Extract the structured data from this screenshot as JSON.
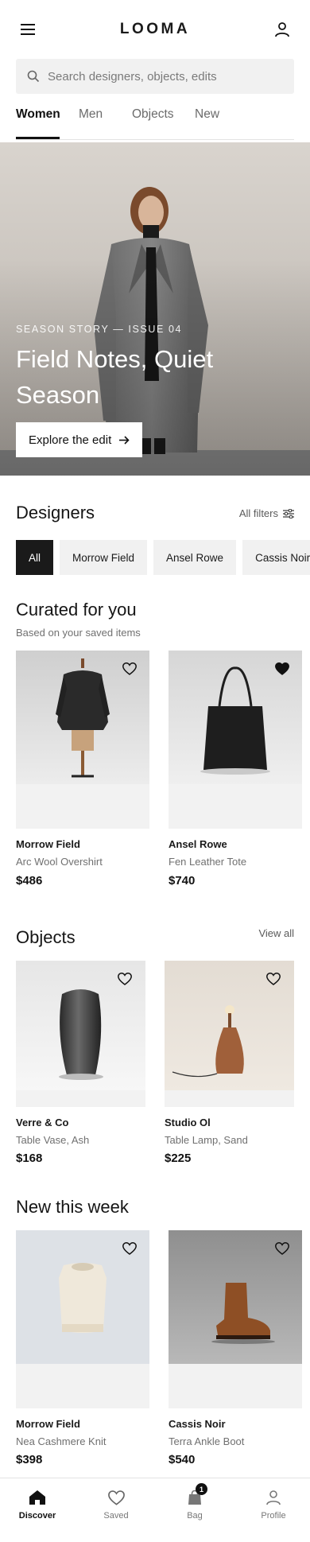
{
  "header": {
    "brand": "LOOMA",
    "menu_icon": "menu-icon",
    "profile_icon": "user-icon"
  },
  "search": {
    "placeholder": "Search designers, objects, edits",
    "icon": "search-icon"
  },
  "tabs": [
    {
      "label": "Women",
      "active": true
    },
    {
      "label": "Men",
      "active": false
    },
    {
      "label": "Objects",
      "active": false
    },
    {
      "label": "New",
      "active": false
    }
  ],
  "hero": {
    "eyebrow": "SEASON STORY — ISSUE 04",
    "title": "Field Notes, Quiet Season",
    "cta_label": "Explore the edit",
    "cta_icon": "arrow-right-icon"
  },
  "designers": {
    "title": "Designers",
    "filters_label": "All filters",
    "filters_icon": "sliders-icon",
    "chips": [
      {
        "label": "All",
        "active": true
      },
      {
        "label": "Morrow Field",
        "active": false
      },
      {
        "label": "Ansel Rowe",
        "active": false
      },
      {
        "label": "Cassis Noir",
        "active": false
      }
    ]
  },
  "curated": {
    "title": "Curated for you",
    "subtitle": "Based on your saved items",
    "items": [
      {
        "brand": "Morrow Field",
        "name": "Arc Wool Overshirt",
        "price": "$486",
        "saved": false
      },
      {
        "brand": "Ansel Rowe",
        "name": "Fen Leather Tote",
        "price": "$740",
        "saved": true
      }
    ]
  },
  "objects": {
    "title": "Objects",
    "link_label": "View all",
    "items": [
      {
        "brand": "Verre & Co",
        "name": "Table Vase, Ash",
        "price": "$168",
        "saved": false
      },
      {
        "brand": "Studio Ol",
        "name": "Table Lamp, Sand",
        "price": "$225",
        "saved": false
      }
    ]
  },
  "new_this_week": {
    "title": "New this week",
    "items": [
      {
        "brand": "Morrow Field",
        "name": "Nea Cashmere Knit",
        "price": "$398",
        "saved": false
      },
      {
        "brand": "Cassis Noir",
        "name": "Terra Ankle Boot",
        "price": "$540",
        "saved": false
      }
    ]
  },
  "bottom_nav": [
    {
      "label": "Discover",
      "icon": "home-icon",
      "active": true
    },
    {
      "label": "Saved",
      "icon": "heart-icon",
      "active": false
    },
    {
      "label": "Bag",
      "icon": "bag-icon",
      "active": false,
      "badge": "1"
    },
    {
      "label": "Profile",
      "icon": "user-icon",
      "active": false
    }
  ],
  "colors": {
    "ink": "#1a1a1a",
    "muted": "#707070",
    "surface": "#f1f1f1"
  }
}
